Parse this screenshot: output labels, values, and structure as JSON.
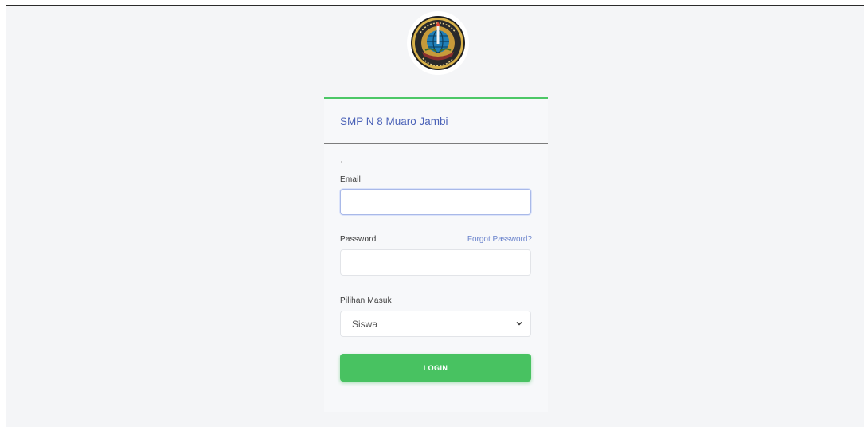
{
  "logo": {
    "icon": "school-emblem-icon",
    "lettering": "SMP NEGERI 8 MUARO JAMBI"
  },
  "card": {
    "title": "SMP N 8 Muaro Jambi",
    "accent_color": "#4cc766"
  },
  "form": {
    "email_label": "Email",
    "email_value": "",
    "password_label": "Password",
    "forgot_link": "Forgot Password?",
    "password_value": "",
    "login_choice_label": "Pilihan Masuk",
    "login_choice_value": "Siswa",
    "login_button": "LOGIN",
    "button_color": "#48c261",
    "link_color": "#6a83cc"
  }
}
